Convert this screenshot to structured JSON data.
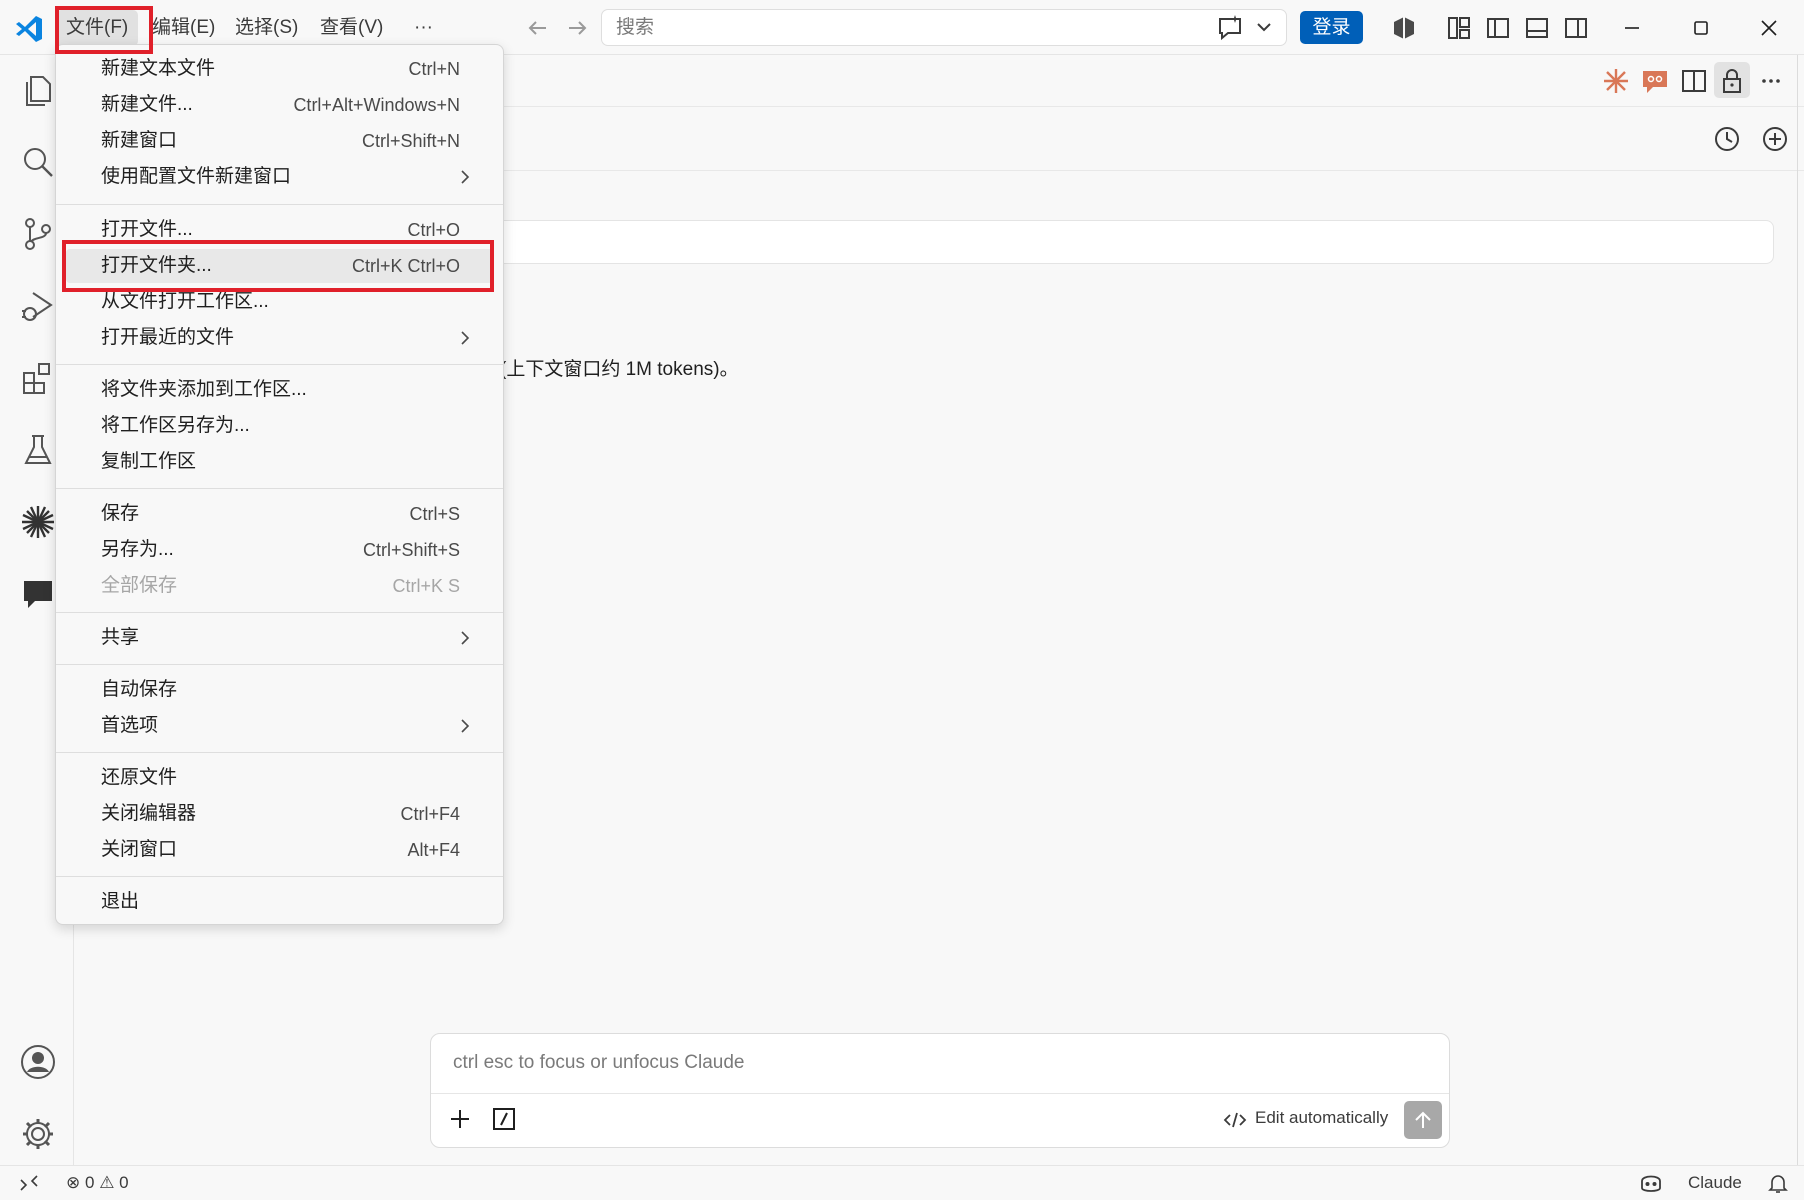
{
  "titlebar": {
    "menus": [
      "文件(F)",
      "编辑(E)",
      "选择(S)",
      "查看(V)",
      "···"
    ],
    "search_placeholder": "搜索",
    "login_label": "登录"
  },
  "file_menu": {
    "groups": [
      [
        {
          "label": "新建文本文件",
          "shortcut": "Ctrl+N"
        },
        {
          "label": "新建文件...",
          "shortcut": "Ctrl+Alt+Windows+N"
        },
        {
          "label": "新建窗口",
          "shortcut": "Ctrl+Shift+N"
        },
        {
          "label": "使用配置文件新建窗口",
          "shortcut": "",
          "submenu": true
        }
      ],
      [
        {
          "label": "打开文件...",
          "shortcut": "Ctrl+O"
        },
        {
          "label": "打开文件夹...",
          "shortcut": "Ctrl+K Ctrl+O",
          "highlighted": true
        },
        {
          "label": "从文件打开工作区...",
          "shortcut": ""
        },
        {
          "label": "打开最近的文件",
          "shortcut": "",
          "submenu": true
        }
      ],
      [
        {
          "label": "将文件夹添加到工作区...",
          "shortcut": ""
        },
        {
          "label": "将工作区另存为...",
          "shortcut": ""
        },
        {
          "label": "复制工作区",
          "shortcut": ""
        }
      ],
      [
        {
          "label": "保存",
          "shortcut": "Ctrl+S"
        },
        {
          "label": "另存为...",
          "shortcut": "Ctrl+Shift+S"
        },
        {
          "label": "全部保存",
          "shortcut": "Ctrl+K S",
          "disabled": true
        }
      ],
      [
        {
          "label": "共享",
          "shortcut": "",
          "submenu": true
        }
      ],
      [
        {
          "label": "自动保存",
          "shortcut": ""
        },
        {
          "label": "首选项",
          "shortcut": "",
          "submenu": true
        }
      ],
      [
        {
          "label": "还原文件",
          "shortcut": ""
        },
        {
          "label": "关闭编辑器",
          "shortcut": "Ctrl+F4"
        },
        {
          "label": "关闭窗口",
          "shortcut": "Alt+F4"
        }
      ],
      [
        {
          "label": "退出",
          "shortcut": ""
        }
      ]
    ]
  },
  "editor": {
    "context_text": "(上下文窗口约 1M tokens)。"
  },
  "chat": {
    "placeholder": "ctrl esc to focus or unfocus Claude",
    "edit_mode_label": "Edit automatically"
  },
  "statusbar": {
    "errors": "0",
    "warnings": "0",
    "claude_label": "Claude"
  },
  "colors": {
    "accent": "#005fb8",
    "annotation": "#e0202a",
    "claude_orange": "#d97757",
    "strip_green": "#82c95f"
  }
}
